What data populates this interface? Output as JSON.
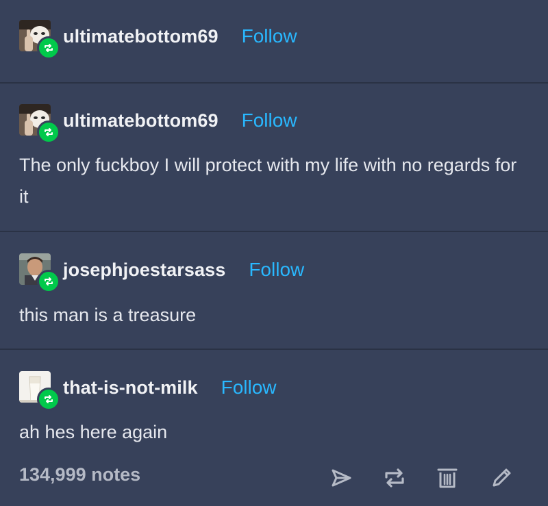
{
  "posts": [
    {
      "username": "ultimatebottom69",
      "follow_label": "Follow",
      "text": ""
    },
    {
      "username": "ultimatebottom69",
      "follow_label": "Follow",
      "text": "The only fuckboy I will protect with my life with no regards for it"
    },
    {
      "username": "josephjoestarsass",
      "follow_label": "Follow",
      "text": "this man is a treasure"
    },
    {
      "username": "that-is-not-milk",
      "follow_label": "Follow",
      "text": "ah hes here again"
    }
  ],
  "footer": {
    "notes": "134,999 notes",
    "actions": [
      "share-icon",
      "reblog-icon",
      "delete-icon",
      "edit-icon"
    ]
  },
  "colors": {
    "background": "#37415a",
    "divider": "#2a3245",
    "follow": "#29b8ff",
    "reblog_badge": "#01c94b",
    "notes": "#b5bac6"
  }
}
